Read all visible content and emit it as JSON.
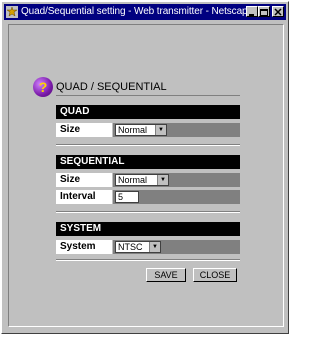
{
  "window": {
    "title": "Quad/Sequential setting - Web transmitter - Netscape"
  },
  "page": {
    "title": "QUAD / SEQUENTIAL"
  },
  "quad": {
    "header": "QUAD",
    "size_label": "Size",
    "size_value": "Normal"
  },
  "sequential": {
    "header": "SEQUENTIAL",
    "size_label": "Size",
    "size_value": "Normal",
    "interval_label": "Interval",
    "interval_value": "5"
  },
  "system": {
    "header": "SYSTEM",
    "system_label": "System",
    "system_value": "NTSC"
  },
  "buttons": {
    "save": "SAVE",
    "close": "CLOSE"
  },
  "colors": {
    "titlebar": "#000080",
    "section_header": "#000000",
    "value_cell": "#808080",
    "help_icon": "#7a1aa8"
  },
  "icons": {
    "window_icon": "netscape-icon",
    "help_icon": "question-mark-icon"
  }
}
